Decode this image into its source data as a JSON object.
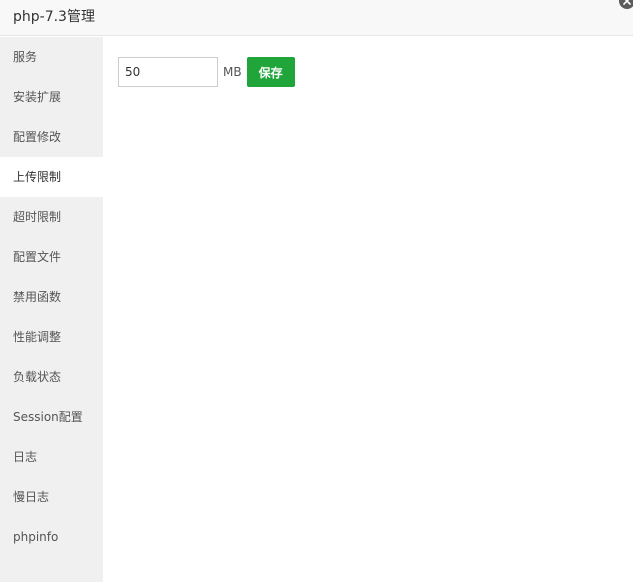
{
  "window": {
    "title": "php-7.3管理",
    "close_icon": "close-icon"
  },
  "sidebar": {
    "active_index": 3,
    "items": [
      {
        "label": "服务"
      },
      {
        "label": "安装扩展"
      },
      {
        "label": "配置修改"
      },
      {
        "label": "上传限制"
      },
      {
        "label": "超时限制"
      },
      {
        "label": "配置文件"
      },
      {
        "label": "禁用函数"
      },
      {
        "label": "性能调整"
      },
      {
        "label": "负载状态"
      },
      {
        "label": "Session配置"
      },
      {
        "label": "日志"
      },
      {
        "label": "慢日志"
      },
      {
        "label": "phpinfo"
      }
    ]
  },
  "upload_limit": {
    "value": "50",
    "unit": "MB",
    "save_label": "保存"
  },
  "colors": {
    "accent": "#20a53a",
    "sidebar_bg": "#f0f0f0",
    "titlebar_bg": "#f8f8f8"
  }
}
